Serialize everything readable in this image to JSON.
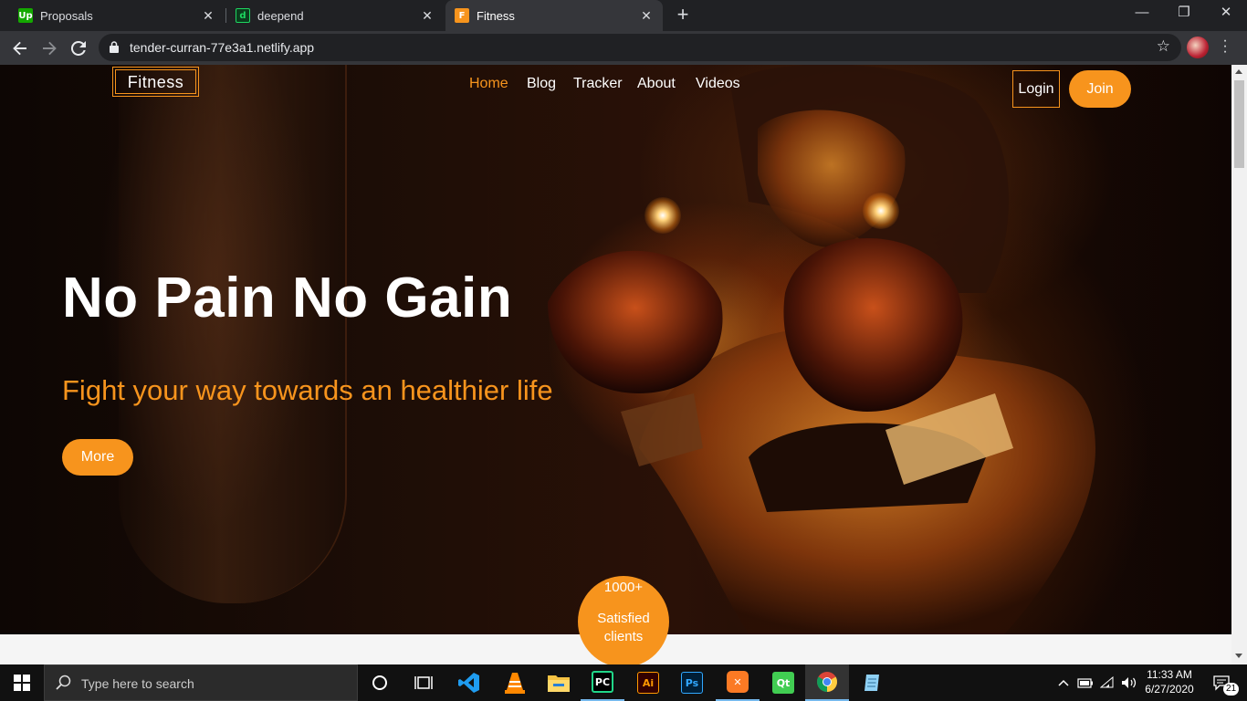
{
  "browser": {
    "tabs": [
      {
        "title": "Proposals",
        "favicon": "Up",
        "favicon_color": "#14a800"
      },
      {
        "title": "deepend",
        "favicon": "d",
        "favicon_color": "#1ed760"
      },
      {
        "title": "Fitness",
        "favicon": "F",
        "favicon_color": "#f7941d"
      }
    ],
    "close_glyph": "✕",
    "new_tab_glyph": "+",
    "url": "tender-curran-77e3a1.netlify.app",
    "window_controls": {
      "minimize": "—",
      "restore": "❐",
      "close": "✕"
    }
  },
  "site": {
    "logo": "Fitness",
    "nav": [
      {
        "label": "Home",
        "active": true
      },
      {
        "label": "Blog"
      },
      {
        "label": "Tracker"
      },
      {
        "label": "About"
      },
      {
        "label": "Videos"
      }
    ],
    "login_label": "Login",
    "join_label": "Join",
    "hero_title": "No Pain No Gain",
    "hero_subtitle": "Fight your way towards an healthier life",
    "more_label": "More",
    "stat_number": "1000+",
    "stat_label": "Satisfied clients",
    "accent_color": "#f7941d"
  },
  "taskbar": {
    "search_placeholder": "Type here to search",
    "apps": [
      "cortana-icon",
      "task-view-icon",
      "vscode-icon",
      "vlc-icon",
      "file-explorer-icon",
      "pycharm-icon",
      "illustrator-icon",
      "photoshop-icon",
      "xampp-icon",
      "qt-icon",
      "chrome-icon",
      "notepad-icon"
    ],
    "app_labels": {
      "pycharm": "PC",
      "illustrator": "Ai",
      "photoshop": "Ps",
      "qt": "Qt"
    },
    "time": "11:33 AM",
    "date": "6/27/2020",
    "notification_count": "21"
  }
}
